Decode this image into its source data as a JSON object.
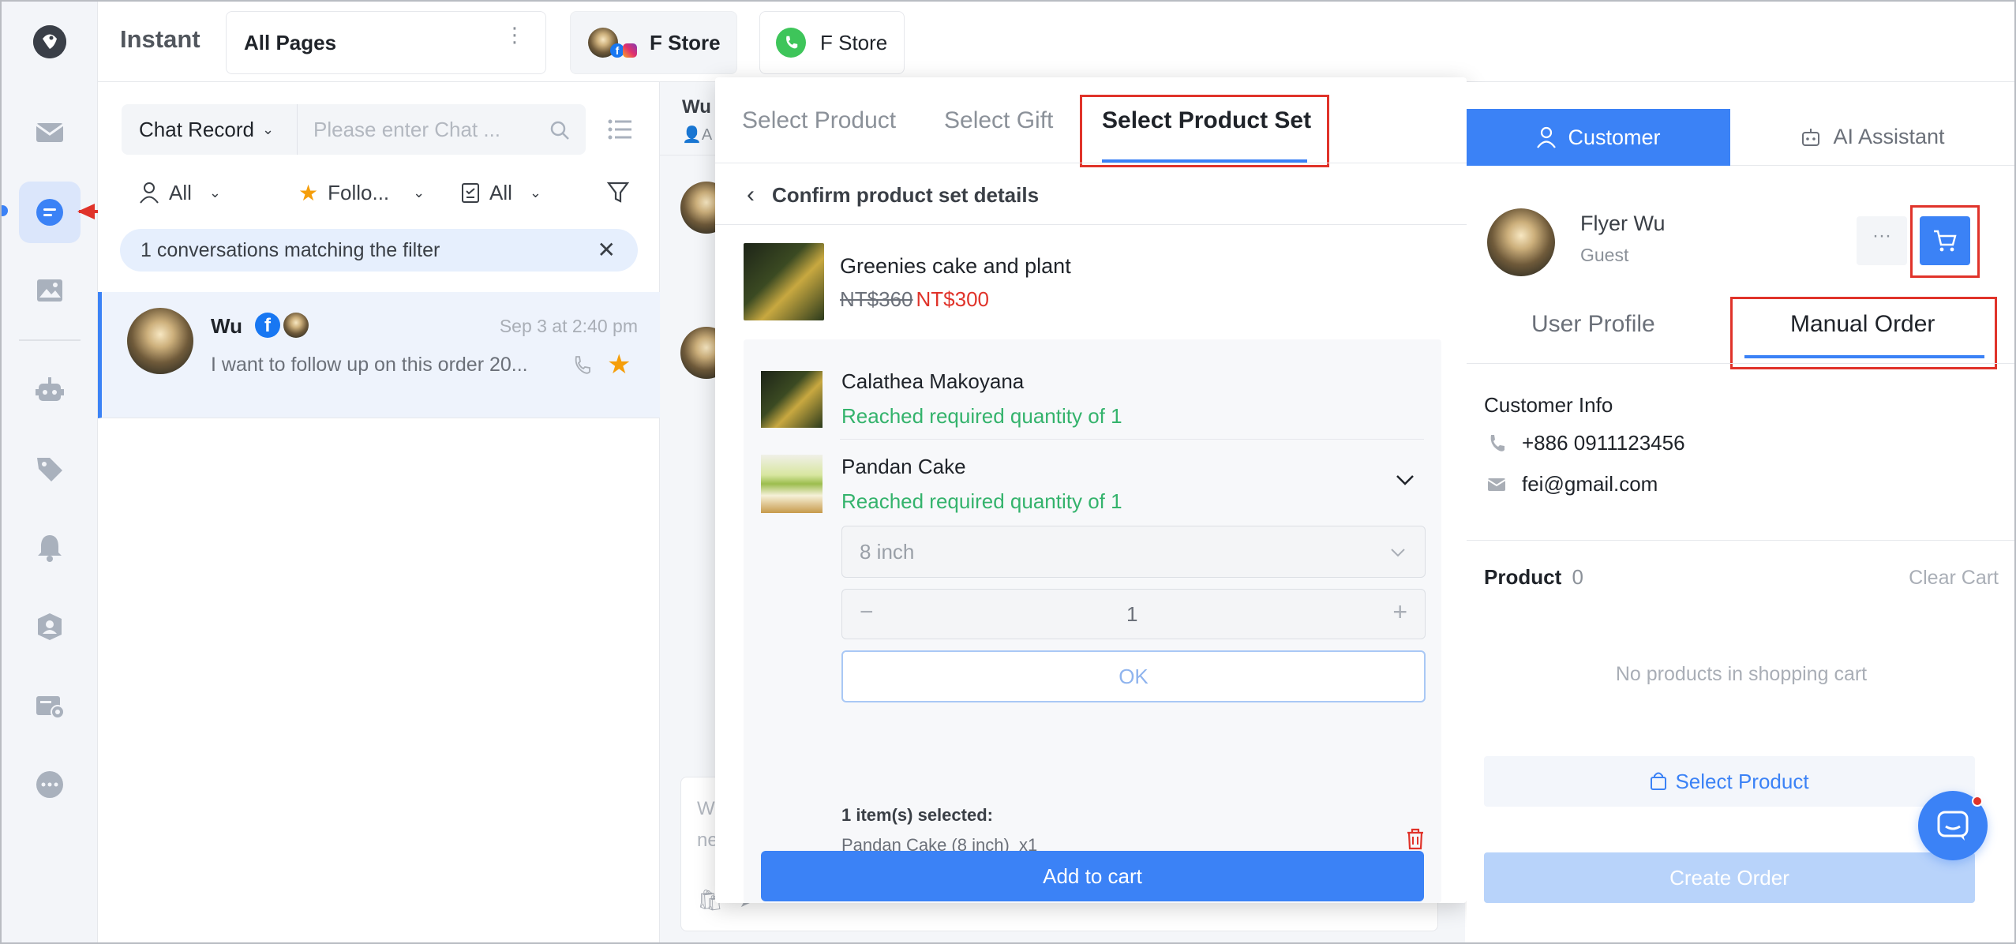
{
  "app": {
    "name": "Instant"
  },
  "header": {
    "page_selector": "All Pages",
    "store_tabs": [
      {
        "label": "F Store",
        "type": "social"
      },
      {
        "label": "F Store",
        "type": "whatsapp"
      }
    ]
  },
  "sidebar": {
    "items": [
      {
        "icon": "mail-icon"
      },
      {
        "icon": "chat-icon",
        "active": true
      },
      {
        "icon": "image-icon"
      },
      {
        "icon": "bot-icon"
      },
      {
        "icon": "tag-icon"
      },
      {
        "icon": "bell-icon"
      },
      {
        "icon": "contact-icon"
      },
      {
        "icon": "ticket-icon"
      },
      {
        "icon": "more-icon"
      }
    ]
  },
  "list": {
    "record_select": "Chat Record",
    "search_placeholder": "Please enter Chat ...",
    "filters": [
      "All",
      "Follo...",
      "All"
    ],
    "banner": "1 conversations matching the filter",
    "conversations": [
      {
        "name": "Wu",
        "time": "Sep 3 at 2:40 pm",
        "preview": "I want to follow up on this order 20..."
      }
    ]
  },
  "conversation": {
    "header_name": "Wu",
    "header_sub": "A",
    "composer_placeholder": "W\nne"
  },
  "modal": {
    "tabs": [
      "Select Product",
      "Select Gift",
      "Select Product Set"
    ],
    "back_title": "Confirm product set details",
    "product": {
      "name": "Greenies cake and plant",
      "original_price": "NT$360",
      "price": "NT$300"
    },
    "items": [
      {
        "name": "Calathea Makoyana",
        "status": "Reached required quantity of 1"
      },
      {
        "name": "Pandan Cake",
        "status": "Reached required quantity of 1"
      }
    ],
    "variant_select": "8 inch",
    "quantity": "1",
    "ok_label": "OK",
    "selected_title": "1 item(s) selected:",
    "selected_item": "Pandan Cake (8 inch)  x1",
    "add_to_cart": "Add to cart"
  },
  "right": {
    "tabs": [
      "Customer",
      "AI Assistant"
    ],
    "customer": {
      "name": "Flyer Wu",
      "role": "Guest"
    },
    "subtabs": [
      "User Profile",
      "Manual Order"
    ],
    "info_title": "Customer Info",
    "phone": "+886 0911123456",
    "email": "fei@gmail.com",
    "product_label": "Product",
    "product_count": "0",
    "clear_cart": "Clear Cart",
    "empty_cart": "No products in shopping cart",
    "select_product": "Select Product",
    "create_order": "Create Order"
  },
  "colors": {
    "primary": "#3b82f6",
    "danger": "#e0332a",
    "success": "#34b36c",
    "highlight": "#e0332a"
  }
}
